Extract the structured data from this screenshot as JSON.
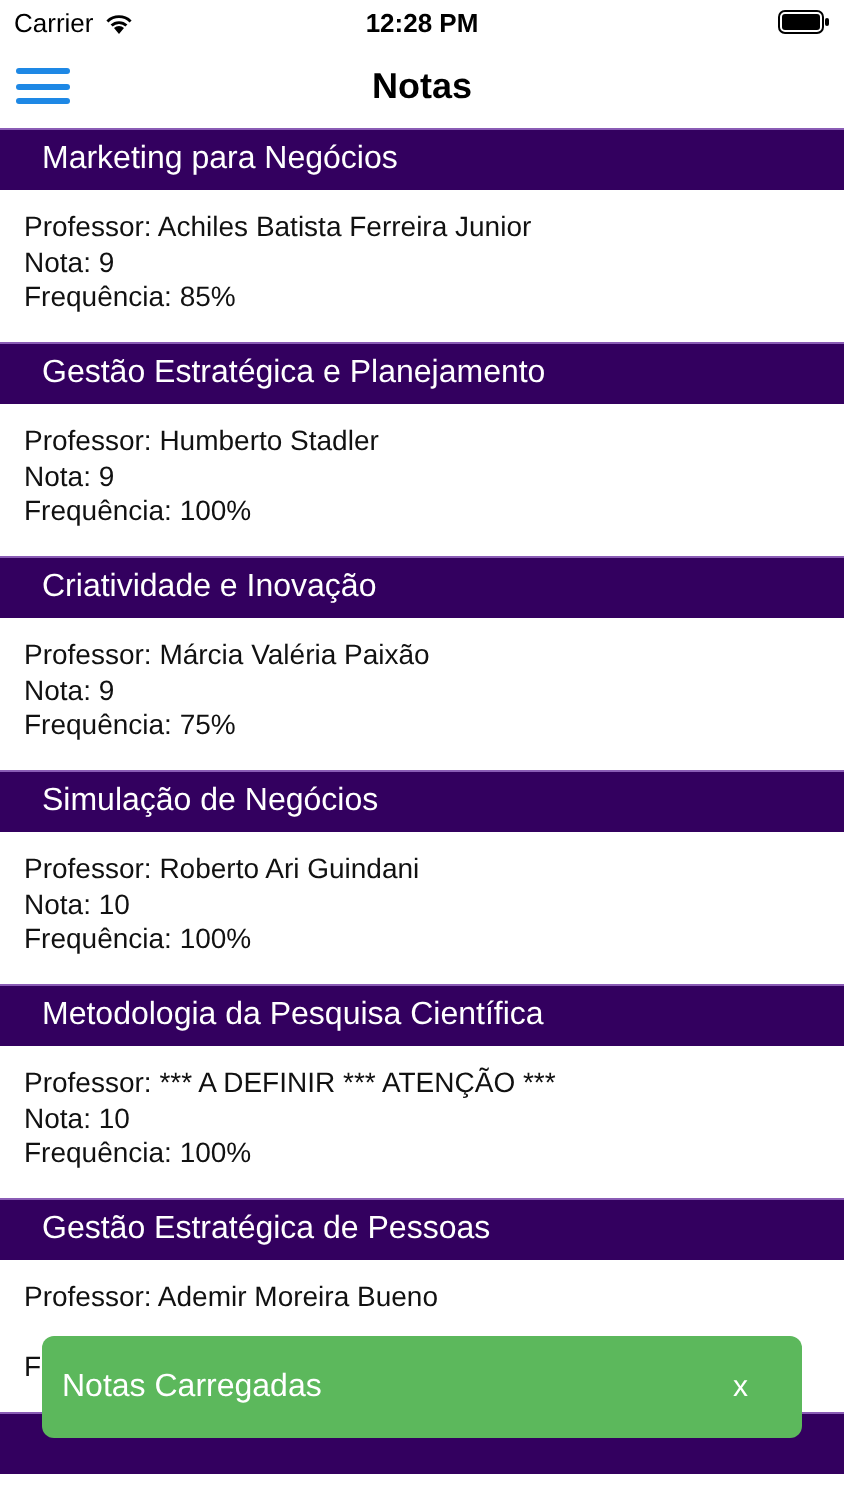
{
  "status_bar": {
    "carrier": "Carrier",
    "time": "12:28 PM"
  },
  "nav": {
    "title": "Notas"
  },
  "courses": [
    {
      "title": "Marketing para Negócios",
      "professor": "Professor: Achiles Batista Ferreira Junior",
      "grade": "Nota: 9",
      "attendance": "Frequência: 85%"
    },
    {
      "title": "Gestão Estratégica e Planejamento",
      "professor": "Professor: Humberto Stadler",
      "grade": "Nota: 9",
      "attendance": "Frequência: 100%"
    },
    {
      "title": "Criatividade e Inovação",
      "professor": "Professor: Márcia Valéria Paixão",
      "grade": "Nota: 9",
      "attendance": "Frequência: 75%"
    },
    {
      "title": "Simulação de Negócios",
      "professor": "Professor: Roberto Ari Guindani",
      "grade": "Nota: 10",
      "attendance": "Frequência: 100%"
    },
    {
      "title": "Metodologia da Pesquisa Científica",
      "professor": "Professor: ***  A DEFINIR *** ATENÇÃO ***",
      "grade": "Nota: 10",
      "attendance": "Frequência: 100%"
    },
    {
      "title": "Gestão Estratégica de Pessoas",
      "professor": "Professor: Ademir Moreira Bueno",
      "attendance": "F"
    },
    {
      "kind": "header"
    }
  ],
  "toast": {
    "message": "Notas Carregadas",
    "close": "x"
  }
}
